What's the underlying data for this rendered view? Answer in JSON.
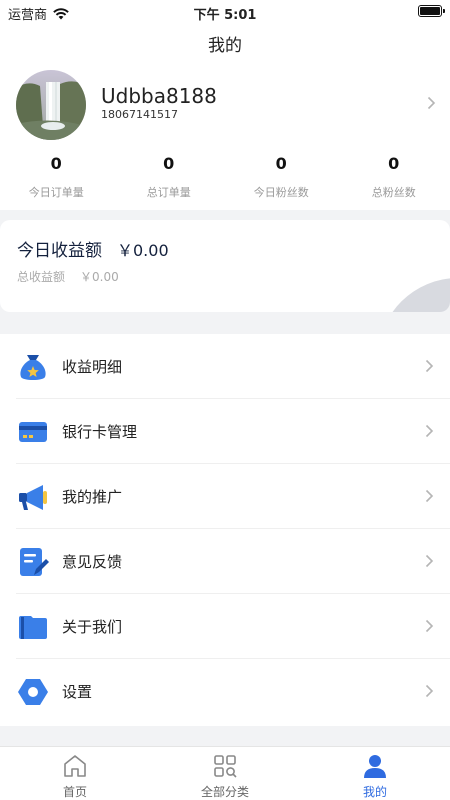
{
  "status_bar": {
    "carrier": "运营商",
    "time": "下午 5:01"
  },
  "nav": {
    "title": "我的"
  },
  "profile": {
    "username": "Udbba8188",
    "phone": "18067141517"
  },
  "stats": [
    {
      "value": "0",
      "label": "今日订单量"
    },
    {
      "value": "0",
      "label": "总订单量"
    },
    {
      "value": "0",
      "label": "今日粉丝数"
    },
    {
      "value": "0",
      "label": "总粉丝数"
    }
  ],
  "earnings": {
    "today_label": "今日收益额",
    "today_value": "￥0.00",
    "total_label": "总收益额",
    "total_value": "￥0.00"
  },
  "menu": [
    {
      "label": "收益明细",
      "icon": "money-bag-icon"
    },
    {
      "label": "银行卡管理",
      "icon": "bank-card-icon"
    },
    {
      "label": "我的推广",
      "icon": "megaphone-icon"
    },
    {
      "label": "意见反馈",
      "icon": "feedback-icon"
    },
    {
      "label": "关于我们",
      "icon": "book-icon"
    },
    {
      "label": "设置",
      "icon": "settings-icon"
    }
  ],
  "tabs": [
    {
      "label": "首页",
      "icon": "home-icon"
    },
    {
      "label": "全部分类",
      "icon": "categories-icon"
    },
    {
      "label": "我的",
      "icon": "user-icon",
      "active": true
    }
  ],
  "colors": {
    "accent": "#2f6be0",
    "icon_blue": "#3a7fe8",
    "icon_dark": "#1b4fa8"
  }
}
